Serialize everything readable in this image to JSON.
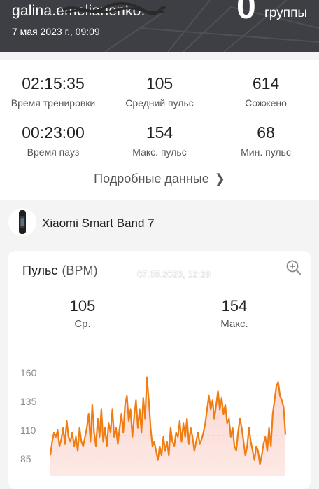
{
  "header": {
    "account": "galina.emelianenko.",
    "datetime": "7 мая 2023 г., 09:09",
    "group_count": "0",
    "group_label": "группы"
  },
  "stats": [
    {
      "value": "02:15:35",
      "label": "Время тренировки"
    },
    {
      "value": "105",
      "label": "Средний пульс"
    },
    {
      "value": "614",
      "label": "Сожжено"
    },
    {
      "value": "00:23:00",
      "label": "Время пауз"
    },
    {
      "value": "154",
      "label": "Макс. пульс"
    },
    {
      "value": "68",
      "label": "Мин. пульс"
    }
  ],
  "details_link": "Подробные данные",
  "device": {
    "name": "Xiaomi Smart Band 7"
  },
  "pulse": {
    "title": "Пульс",
    "unit": "(BPM)",
    "watermark": "07.05.2023, 12:29",
    "average_value": "105",
    "average_label": "Ср.",
    "max_value": "154",
    "max_label": "Макс."
  },
  "colors": {
    "header_bg": "#3d3f44",
    "line": "#f07d12",
    "fill": "#fbd3cc",
    "average_line": "#f2aaa2"
  },
  "chart_data": {
    "type": "area",
    "title": "",
    "xlabel": "",
    "ylabel": "",
    "y_ticks": [
      160,
      135,
      110,
      85
    ],
    "average": 105,
    "ylim": [
      78,
      165
    ],
    "values": [
      88,
      100,
      108,
      104,
      110,
      96,
      102,
      112,
      98,
      118,
      104,
      100,
      108,
      96,
      104,
      92,
      112,
      100,
      96,
      104,
      112,
      124,
      100,
      132,
      108,
      96,
      120,
      104,
      128,
      100,
      112,
      96,
      116,
      108,
      128,
      104,
      112,
      98,
      112,
      124,
      108,
      132,
      140,
      118,
      128,
      104,
      122,
      136,
      112,
      128,
      108,
      138,
      120,
      156,
      136,
      112,
      96,
      100,
      92,
      84,
      96,
      88,
      104,
      92,
      100,
      88,
      112,
      100,
      96,
      108,
      104,
      118,
      100,
      116,
      104,
      120,
      98,
      112,
      104,
      92,
      100,
      108,
      98,
      102,
      108,
      116,
      128,
      140,
      128,
      136,
      120,
      132,
      144,
      128,
      138,
      124,
      132,
      116,
      120,
      104,
      112,
      96,
      92,
      108,
      120,
      112,
      100,
      88,
      96,
      112,
      100,
      92,
      84,
      96,
      92,
      80,
      88,
      98,
      104,
      92,
      112,
      96,
      124,
      136,
      148,
      152,
      140,
      136,
      130,
      106
    ]
  }
}
